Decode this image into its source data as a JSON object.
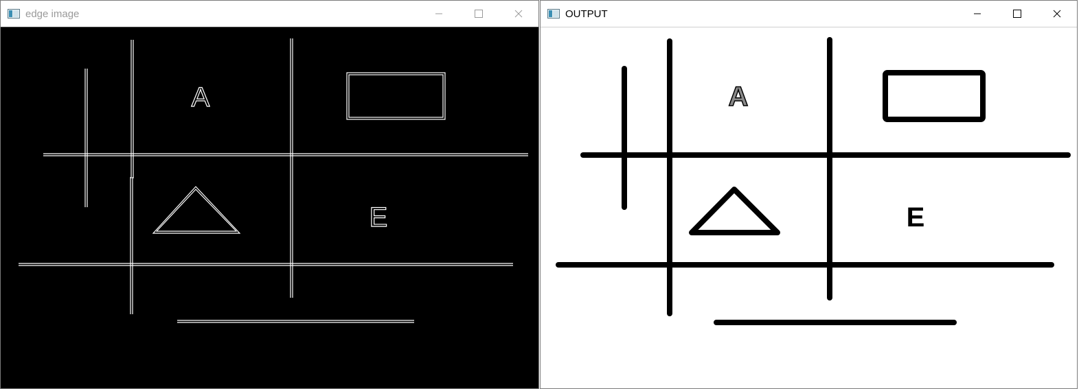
{
  "windows": {
    "left": {
      "title": "edge image",
      "active": false
    },
    "right": {
      "title": "OUTPUT",
      "active": true
    }
  },
  "shapes": {
    "letter_top": "A",
    "letter_bottom": "E"
  },
  "icons": {
    "app": "opencv-window-icon",
    "minimize": "minimize-icon",
    "maximize": "maximize-icon",
    "close": "close-icon"
  },
  "colors": {
    "edge_background": "#000000",
    "edge_stroke": "#ffffff",
    "output_background": "#ffffff",
    "output_stroke": "#000000"
  }
}
